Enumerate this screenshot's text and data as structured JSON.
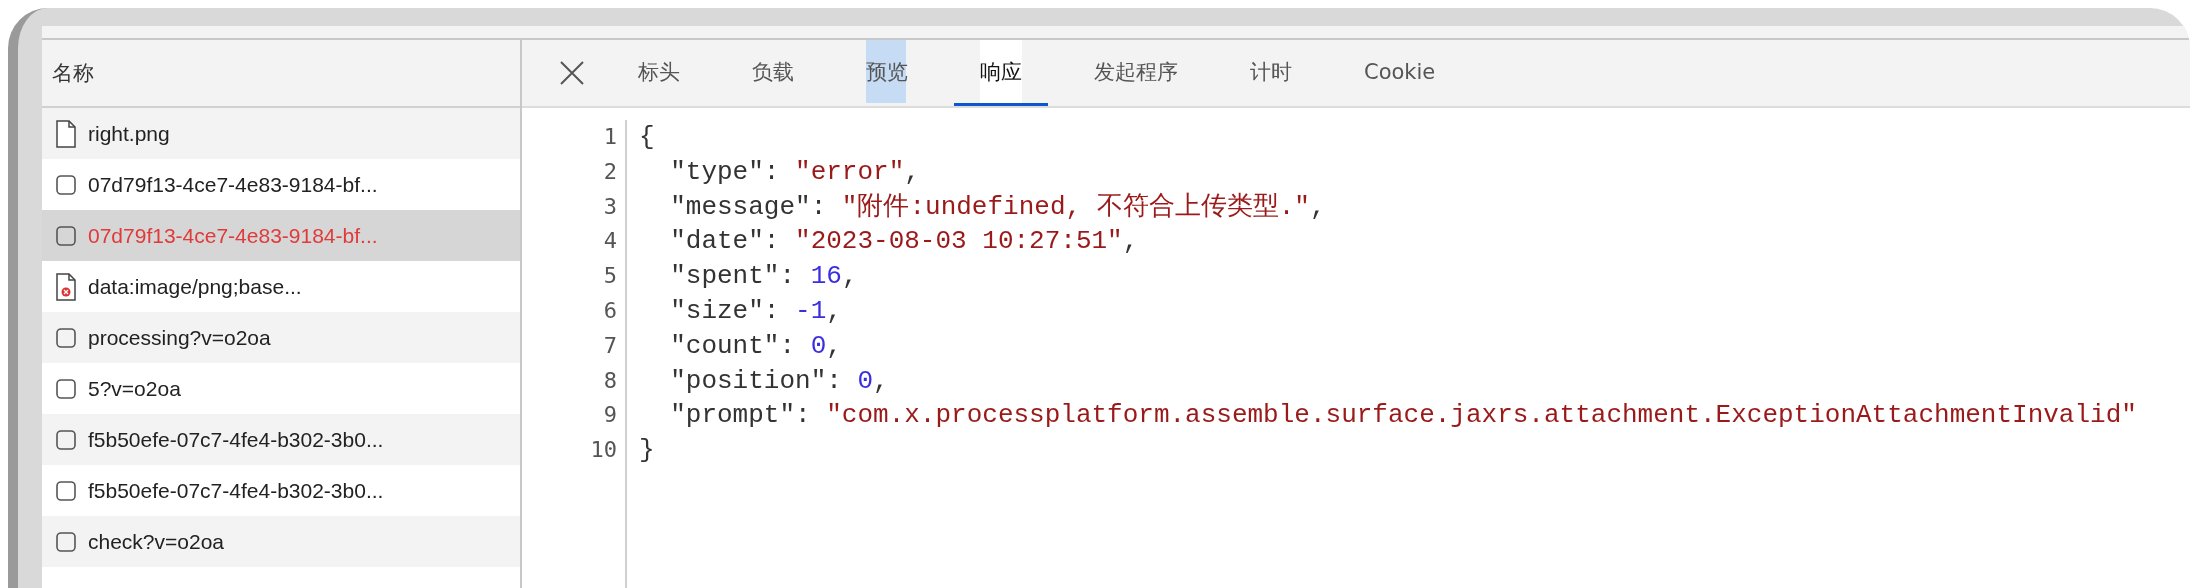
{
  "column_header": "名称",
  "requests": [
    {
      "name": "right.png",
      "kind": "file",
      "error": false,
      "selected": false
    },
    {
      "name": "07d79f13-4ce7-4e83-9184-bf...",
      "kind": "checkbox",
      "error": false,
      "selected": false
    },
    {
      "name": "07d79f13-4ce7-4e83-9184-bf...",
      "kind": "checkbox",
      "error": true,
      "selected": true
    },
    {
      "name": "data:image/png;base...",
      "kind": "broken-image",
      "error": false,
      "selected": false
    },
    {
      "name": "processing?v=o2oa",
      "kind": "checkbox",
      "error": false,
      "selected": false
    },
    {
      "name": "5?v=o2oa",
      "kind": "checkbox",
      "error": false,
      "selected": false
    },
    {
      "name": "f5b50efe-07c7-4fe4-b302-3b0...",
      "kind": "checkbox",
      "error": false,
      "selected": false
    },
    {
      "name": "f5b50efe-07c7-4fe4-b302-3b0...",
      "kind": "checkbox",
      "error": false,
      "selected": false
    },
    {
      "name": "check?v=o2oa",
      "kind": "checkbox",
      "error": false,
      "selected": false
    }
  ],
  "tabs": [
    {
      "label": "标头",
      "selected": false,
      "highlighted": false
    },
    {
      "label": "负载",
      "selected": false,
      "highlighted": false
    },
    {
      "label": "预览",
      "selected": false,
      "highlighted": true
    },
    {
      "label": "响应",
      "selected": true,
      "highlighted": false
    },
    {
      "label": "发起程序",
      "selected": false,
      "highlighted": false
    },
    {
      "label": "计时",
      "selected": false,
      "highlighted": false
    },
    {
      "label": "Cookie",
      "selected": false,
      "highlighted": false
    }
  ],
  "code_lines": [
    {
      "number": "1",
      "tokens": [
        {
          "kind": "punct",
          "text": "{"
        }
      ]
    },
    {
      "number": "2",
      "tokens": [
        {
          "kind": "key",
          "text": "  \"type\""
        },
        {
          "kind": "punct",
          "text": ": "
        },
        {
          "kind": "string",
          "text": "\"error\""
        },
        {
          "kind": "punct",
          "text": ","
        }
      ]
    },
    {
      "number": "3",
      "tokens": [
        {
          "kind": "key",
          "text": "  \"message\""
        },
        {
          "kind": "punct",
          "text": ": "
        },
        {
          "kind": "string",
          "text": "\"附件:undefined, 不符合上传类型.\""
        },
        {
          "kind": "punct",
          "text": ","
        }
      ]
    },
    {
      "number": "4",
      "tokens": [
        {
          "kind": "key",
          "text": "  \"date\""
        },
        {
          "kind": "punct",
          "text": ": "
        },
        {
          "kind": "string",
          "text": "\"2023-08-03 10:27:51\""
        },
        {
          "kind": "punct",
          "text": ","
        }
      ]
    },
    {
      "number": "5",
      "tokens": [
        {
          "kind": "key",
          "text": "  \"spent\""
        },
        {
          "kind": "punct",
          "text": ": "
        },
        {
          "kind": "number",
          "text": "16"
        },
        {
          "kind": "punct",
          "text": ","
        }
      ]
    },
    {
      "number": "6",
      "tokens": [
        {
          "kind": "key",
          "text": "  \"size\""
        },
        {
          "kind": "punct",
          "text": ": "
        },
        {
          "kind": "number",
          "text": "-1"
        },
        {
          "kind": "punct",
          "text": ","
        }
      ]
    },
    {
      "number": "7",
      "tokens": [
        {
          "kind": "key",
          "text": "  \"count\""
        },
        {
          "kind": "punct",
          "text": ": "
        },
        {
          "kind": "number",
          "text": "0"
        },
        {
          "kind": "punct",
          "text": ","
        }
      ]
    },
    {
      "number": "8",
      "tokens": [
        {
          "kind": "key",
          "text": "  \"position\""
        },
        {
          "kind": "punct",
          "text": ": "
        },
        {
          "kind": "number",
          "text": "0"
        },
        {
          "kind": "punct",
          "text": ","
        }
      ]
    },
    {
      "number": "9",
      "tokens": [
        {
          "kind": "key",
          "text": "  \"prompt\""
        },
        {
          "kind": "punct",
          "text": ": "
        },
        {
          "kind": "string",
          "text": "\"com.x.processplatform.assemble.surface.jaxrs.attachment.ExceptionAttachmentInvalid\""
        }
      ]
    },
    {
      "number": "10",
      "tokens": [
        {
          "kind": "punct",
          "text": "}"
        }
      ]
    }
  ]
}
